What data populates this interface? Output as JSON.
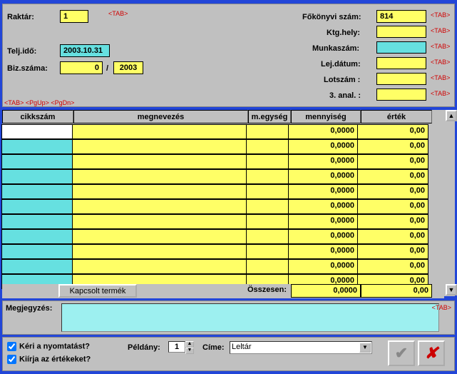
{
  "top": {
    "raktar_label": "Raktár:",
    "raktar_value": "1",
    "teljido_label": "Telj.idő:",
    "teljido_value": "2003.10.31",
    "bizszama_label": "Biz.száma:",
    "bizszama_value1": "0",
    "bizszama_sep": "/",
    "bizszama_value2": "2003",
    "fokonyvi_label": "Főkönyvi szám:",
    "fokonyvi_value": "814",
    "ktghely_label": "Ktg.hely:",
    "ktghely_value": "",
    "munkaszam_label": "Munkaszám:",
    "munkaszam_value": "",
    "lejdatum_label": "Lej.dátum:",
    "lejdatum_value": "",
    "lotszam_label": "Lotszám :",
    "lotszam_value": "",
    "anal3_label": "3. anal. :",
    "anal3_value": "",
    "tab_hint": "<TAB>",
    "nav_hint": "<TAB>  <PgUp>  <PgDn>"
  },
  "grid": {
    "headers": {
      "cikkszam": "cikkszám",
      "megnevezes": "megnevezés",
      "megyseg": "m.egység",
      "mennyiseg": "mennyiség",
      "ertek": "érték"
    },
    "rows": [
      {
        "cikk": "",
        "megn": "",
        "me": "",
        "menny": "0,0000",
        "ert": "0,00",
        "cikk_bg": "white"
      },
      {
        "cikk": "",
        "megn": "",
        "me": "",
        "menny": "0,0000",
        "ert": "0,00",
        "cikk_bg": "cyan"
      },
      {
        "cikk": "",
        "megn": "",
        "me": "",
        "menny": "0,0000",
        "ert": "0,00",
        "cikk_bg": "cyan"
      },
      {
        "cikk": "",
        "megn": "",
        "me": "",
        "menny": "0,0000",
        "ert": "0,00",
        "cikk_bg": "cyan"
      },
      {
        "cikk": "",
        "megn": "",
        "me": "",
        "menny": "0,0000",
        "ert": "0,00",
        "cikk_bg": "cyan"
      },
      {
        "cikk": "",
        "megn": "",
        "me": "",
        "menny": "0,0000",
        "ert": "0,00",
        "cikk_bg": "cyan"
      },
      {
        "cikk": "",
        "megn": "",
        "me": "",
        "menny": "0,0000",
        "ert": "0,00",
        "cikk_bg": "cyan"
      },
      {
        "cikk": "",
        "megn": "",
        "me": "",
        "menny": "0,0000",
        "ert": "0,00",
        "cikk_bg": "cyan"
      },
      {
        "cikk": "",
        "megn": "",
        "me": "",
        "menny": "0,0000",
        "ert": "0,00",
        "cikk_bg": "cyan"
      },
      {
        "cikk": "",
        "megn": "",
        "me": "",
        "menny": "0,0000",
        "ert": "0,00",
        "cikk_bg": "cyan"
      },
      {
        "cikk": "",
        "megn": "",
        "me": "",
        "menny": "0,0000",
        "ert": "0,00",
        "cikk_bg": "cyan"
      }
    ]
  },
  "totals": {
    "kapcsolt_label": "Kapcsolt termék",
    "osszesen_label": "Összesen:",
    "mennyiseg_total": "0,0000",
    "ertek_total": "0,00"
  },
  "notes": {
    "label": "Megjegyzés:",
    "value": ""
  },
  "bottom": {
    "chk1_label": "Kéri a nyomtatást?",
    "chk2_label": "Kiírja az értékeket?",
    "peldany_label": "Példány:",
    "peldany_value": "1",
    "cime_label": "Címe:",
    "cime_value": "Leltár"
  }
}
